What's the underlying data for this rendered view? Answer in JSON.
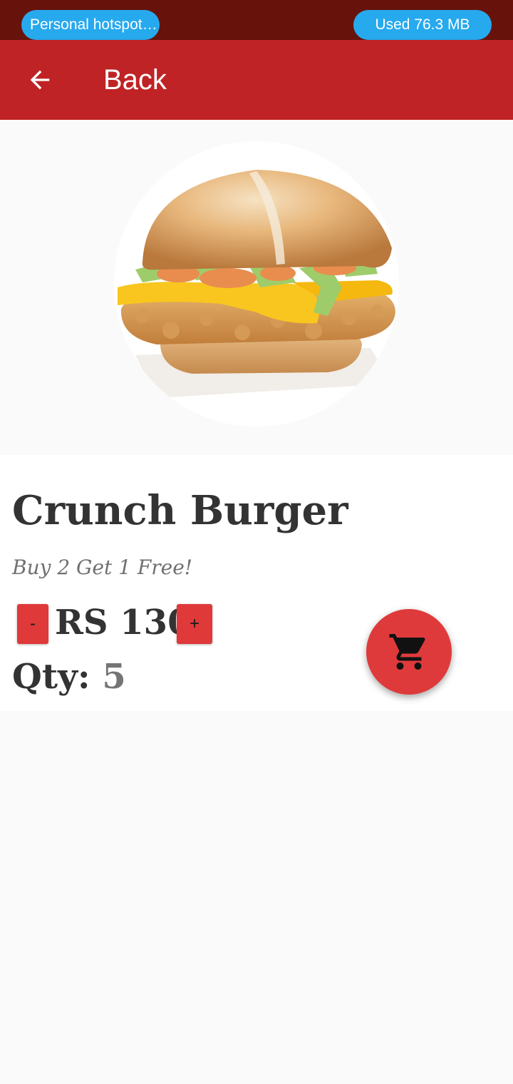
{
  "status_bar": {
    "hotspot_label": "Personal hotspot…",
    "data_usage_label": "Used  76.3 MB"
  },
  "app_bar": {
    "back_label": "Back"
  },
  "product": {
    "name": "Crunch Burger",
    "promo": "Buy 2 Get 1 Free!",
    "price": "RS 130",
    "decrement_label": "-",
    "increment_label": "+",
    "qty_label": "Qty:",
    "qty_value": "5"
  },
  "colors": {
    "status_bar": "#67130b",
    "app_bar": "#c02325",
    "pill": "#27a9ee",
    "accent_button": "#e0393a",
    "fab": "#df3a3b"
  },
  "icons": {
    "back": "arrow-back-icon",
    "cart": "shopping-cart-icon",
    "product_image": "burger-image"
  }
}
